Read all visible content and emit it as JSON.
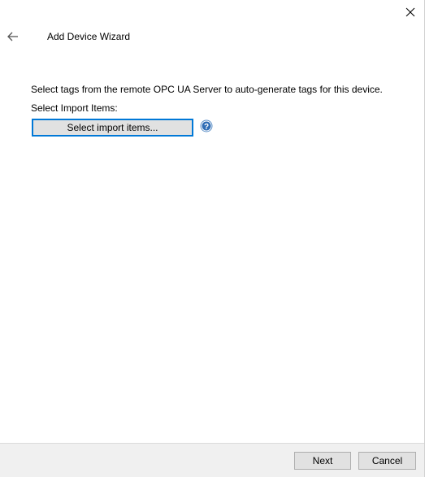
{
  "window": {
    "title": "Add Device Wizard"
  },
  "content": {
    "description": "Select tags from the remote OPC UA Server to auto-generate tags for this device.",
    "import_label": "Select Import Items:",
    "import_button_label": "Select import items..."
  },
  "footer": {
    "next_label": "Next",
    "cancel_label": "Cancel"
  },
  "icons": {
    "close": "close-icon",
    "back": "back-arrow-icon",
    "help": "help-icon"
  },
  "colors": {
    "accent": "#0078d7",
    "button_face": "#e1e1e1",
    "footer_bg": "#f0f0f0"
  }
}
